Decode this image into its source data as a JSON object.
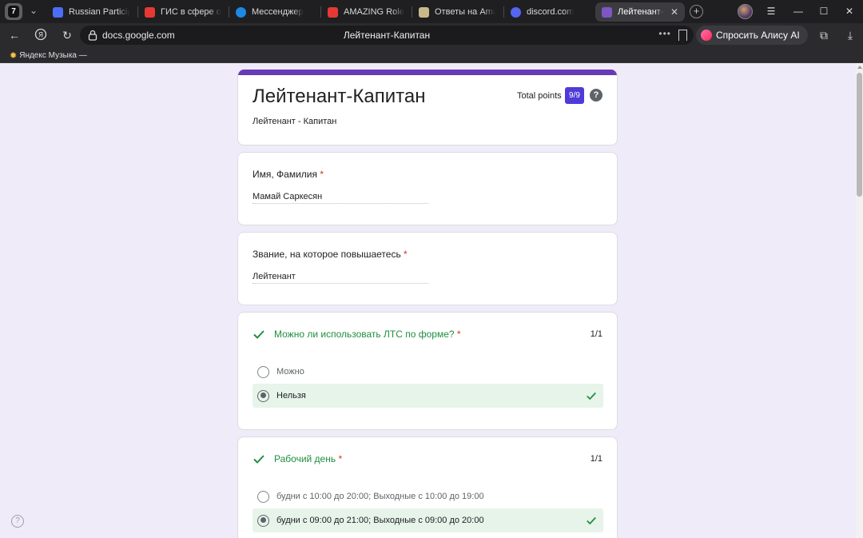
{
  "browser": {
    "app_button_label": "7",
    "tabs": [
      {
        "label": "Russian Participle",
        "favicon_color": "#4c6ef5"
      },
      {
        "label": "ГИС в сфере обра",
        "favicon_color": "#e53935"
      },
      {
        "label": "Мессенджер",
        "favicon_color": "#1e88e5"
      },
      {
        "label": "AMAZING RolePla",
        "favicon_color": "#e53935"
      },
      {
        "label": "Ответы на Amazin",
        "favicon_color": "#c9b98a"
      },
      {
        "label": "discord.com",
        "favicon_color": "#5865f2"
      },
      {
        "label": "Лейтенант-Кап",
        "favicon_color": "#7e57c2",
        "active": true
      }
    ],
    "tab_close_glyph": "✕",
    "new_tab_glyph": "+",
    "url": "docs.google.com",
    "page_title": "Лейтенант-Капитан",
    "alice_button_label": "Спросить Алису AI",
    "bookmark_label": "Яндекс Музыка —"
  },
  "form": {
    "accent_color": "#673ab7",
    "title": "Лейтенант-Капитан",
    "description": "Лейтенант - Капитан",
    "total_points_label": "Total points",
    "total_points_value": "9/9",
    "questions": [
      {
        "title": "Имя, Фамилия",
        "required_mark": "*",
        "answer": "Мамай Саркесян"
      },
      {
        "title": "Звание, на которое повышаетесь",
        "required_mark": "*",
        "answer": "Лейтенант"
      },
      {
        "title": "Можно ли использовать ЛТС по форме?",
        "required_mark": "*",
        "score": "1/1",
        "options": [
          {
            "label": "Можно",
            "selected": false,
            "correct": false
          },
          {
            "label": "Нельзя",
            "selected": true,
            "correct": true
          }
        ]
      },
      {
        "title": "Рабочий день",
        "required_mark": "*",
        "score": "1/1",
        "options": [
          {
            "label": "будни с 10:00 до 20:00; Выходные с 10:00 до 19:00",
            "selected": false,
            "correct": false
          },
          {
            "label": "будни с 09:00 до 21:00; Выходные с 09:00 до 20:00",
            "selected": true,
            "correct": true
          }
        ]
      }
    ]
  },
  "colors": {
    "correct_green": "#1e8e3e",
    "correct_bg": "#e6f4ea",
    "required_red": "#d93025",
    "points_badge": "#4f3bd8"
  }
}
